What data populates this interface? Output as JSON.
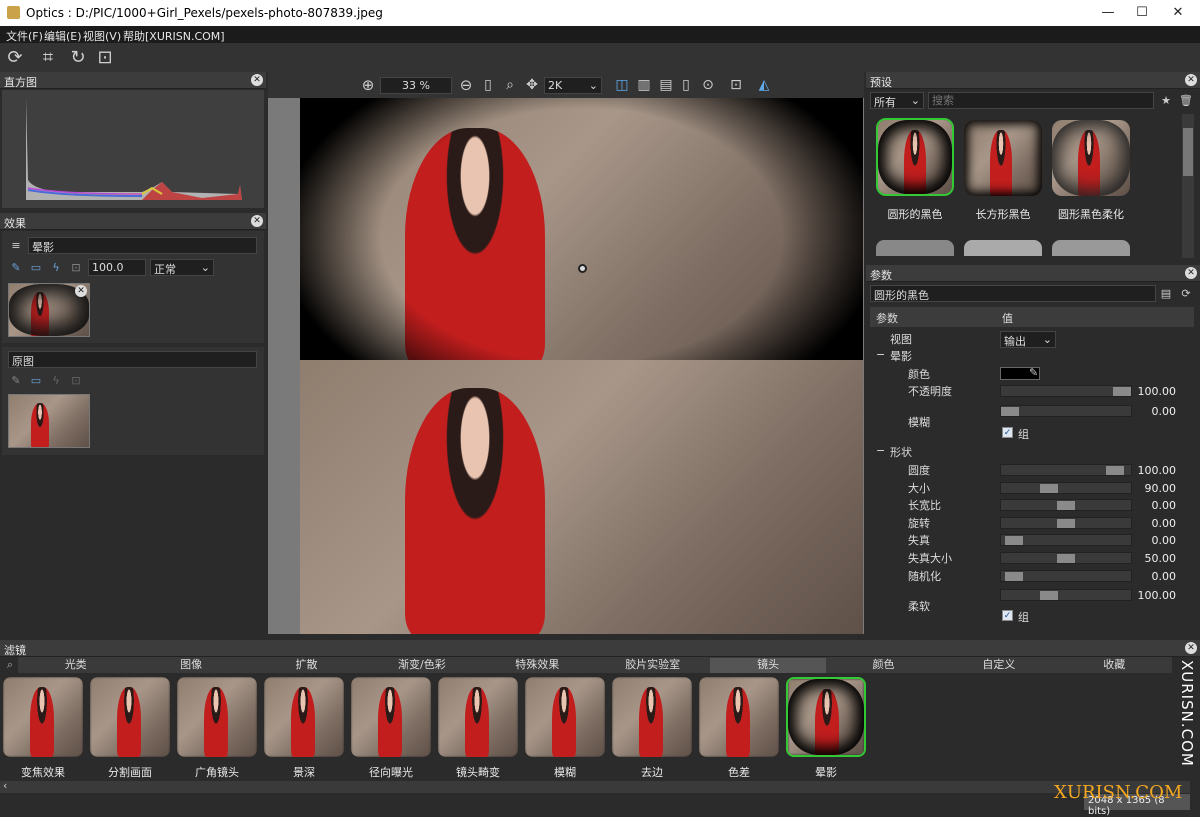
{
  "window": {
    "title": "Optics : D:/PIC/1000+Girl_Pexels/pexels-photo-807839.jpeg",
    "min": "—",
    "max": "☐",
    "close": "✕"
  },
  "menu": [
    "文件(F)",
    "编辑(E)",
    "视图(V)",
    "帮助[XURISN.COM]"
  ],
  "panels": {
    "histogram": "直方图",
    "effects": "效果",
    "effect_name": "晕影",
    "opacity": "100.0",
    "blend_mode": "正常",
    "original": "原图",
    "presets": "预设",
    "params": "参数",
    "filters": "滤镜"
  },
  "viewer": {
    "zoom": "33 %",
    "resolution": "2K"
  },
  "presets": {
    "category": "所有",
    "search_placeholder": "搜索",
    "items": [
      "圆形的黑色",
      "长方形黑色",
      "圆形黑色柔化"
    ]
  },
  "params": {
    "preset_name": "圆形的黑色",
    "col_param": "参数",
    "col_value": "值",
    "view_label": "视图",
    "view_value": "输出",
    "group_vignette": "晕影",
    "color_label": "颜色",
    "opacity_label": "不透明度",
    "opacity_value": "100.00",
    "blur_label": "模糊",
    "blur_value": "0.00",
    "group_label": "组",
    "group_shape": "形状",
    "shape_rows": [
      {
        "label": "圆度",
        "value": "100.00",
        "level": 0.94
      },
      {
        "label": "大小",
        "value": "90.00",
        "level": 0.35
      },
      {
        "label": "长宽比",
        "value": "0.00",
        "level": 0.5
      },
      {
        "label": "旋转",
        "value": "0.00",
        "level": 0.5
      },
      {
        "label": "失真",
        "value": "0.00",
        "level": 0.04
      },
      {
        "label": "失真大小",
        "value": "50.00",
        "level": 0.5
      },
      {
        "label": "随机化",
        "value": "0.00",
        "level": 0.04
      }
    ],
    "soft_label": "柔软",
    "soft_value": "100.00",
    "soft_level": 0.35
  },
  "filter_tabs": [
    "光类",
    "图像",
    "扩散",
    "渐变/色彩",
    "特殊效果",
    "胶片实验室",
    "镜头",
    "颜色",
    "自定义",
    "收藏"
  ],
  "filter_active_tab": "镜头",
  "filter_items": [
    "变焦效果",
    "分割画面",
    "广角镜头",
    "景深",
    "径向曝光",
    "镜头畸变",
    "模糊",
    "去边",
    "色差",
    "晕影"
  ],
  "status": "2048 x 1365 (8 bits)",
  "watermark": "XURISN.COM",
  "colors": {
    "accent": "#34c934",
    "panel": "#2b2b2b",
    "header": "#3c3c3c"
  }
}
